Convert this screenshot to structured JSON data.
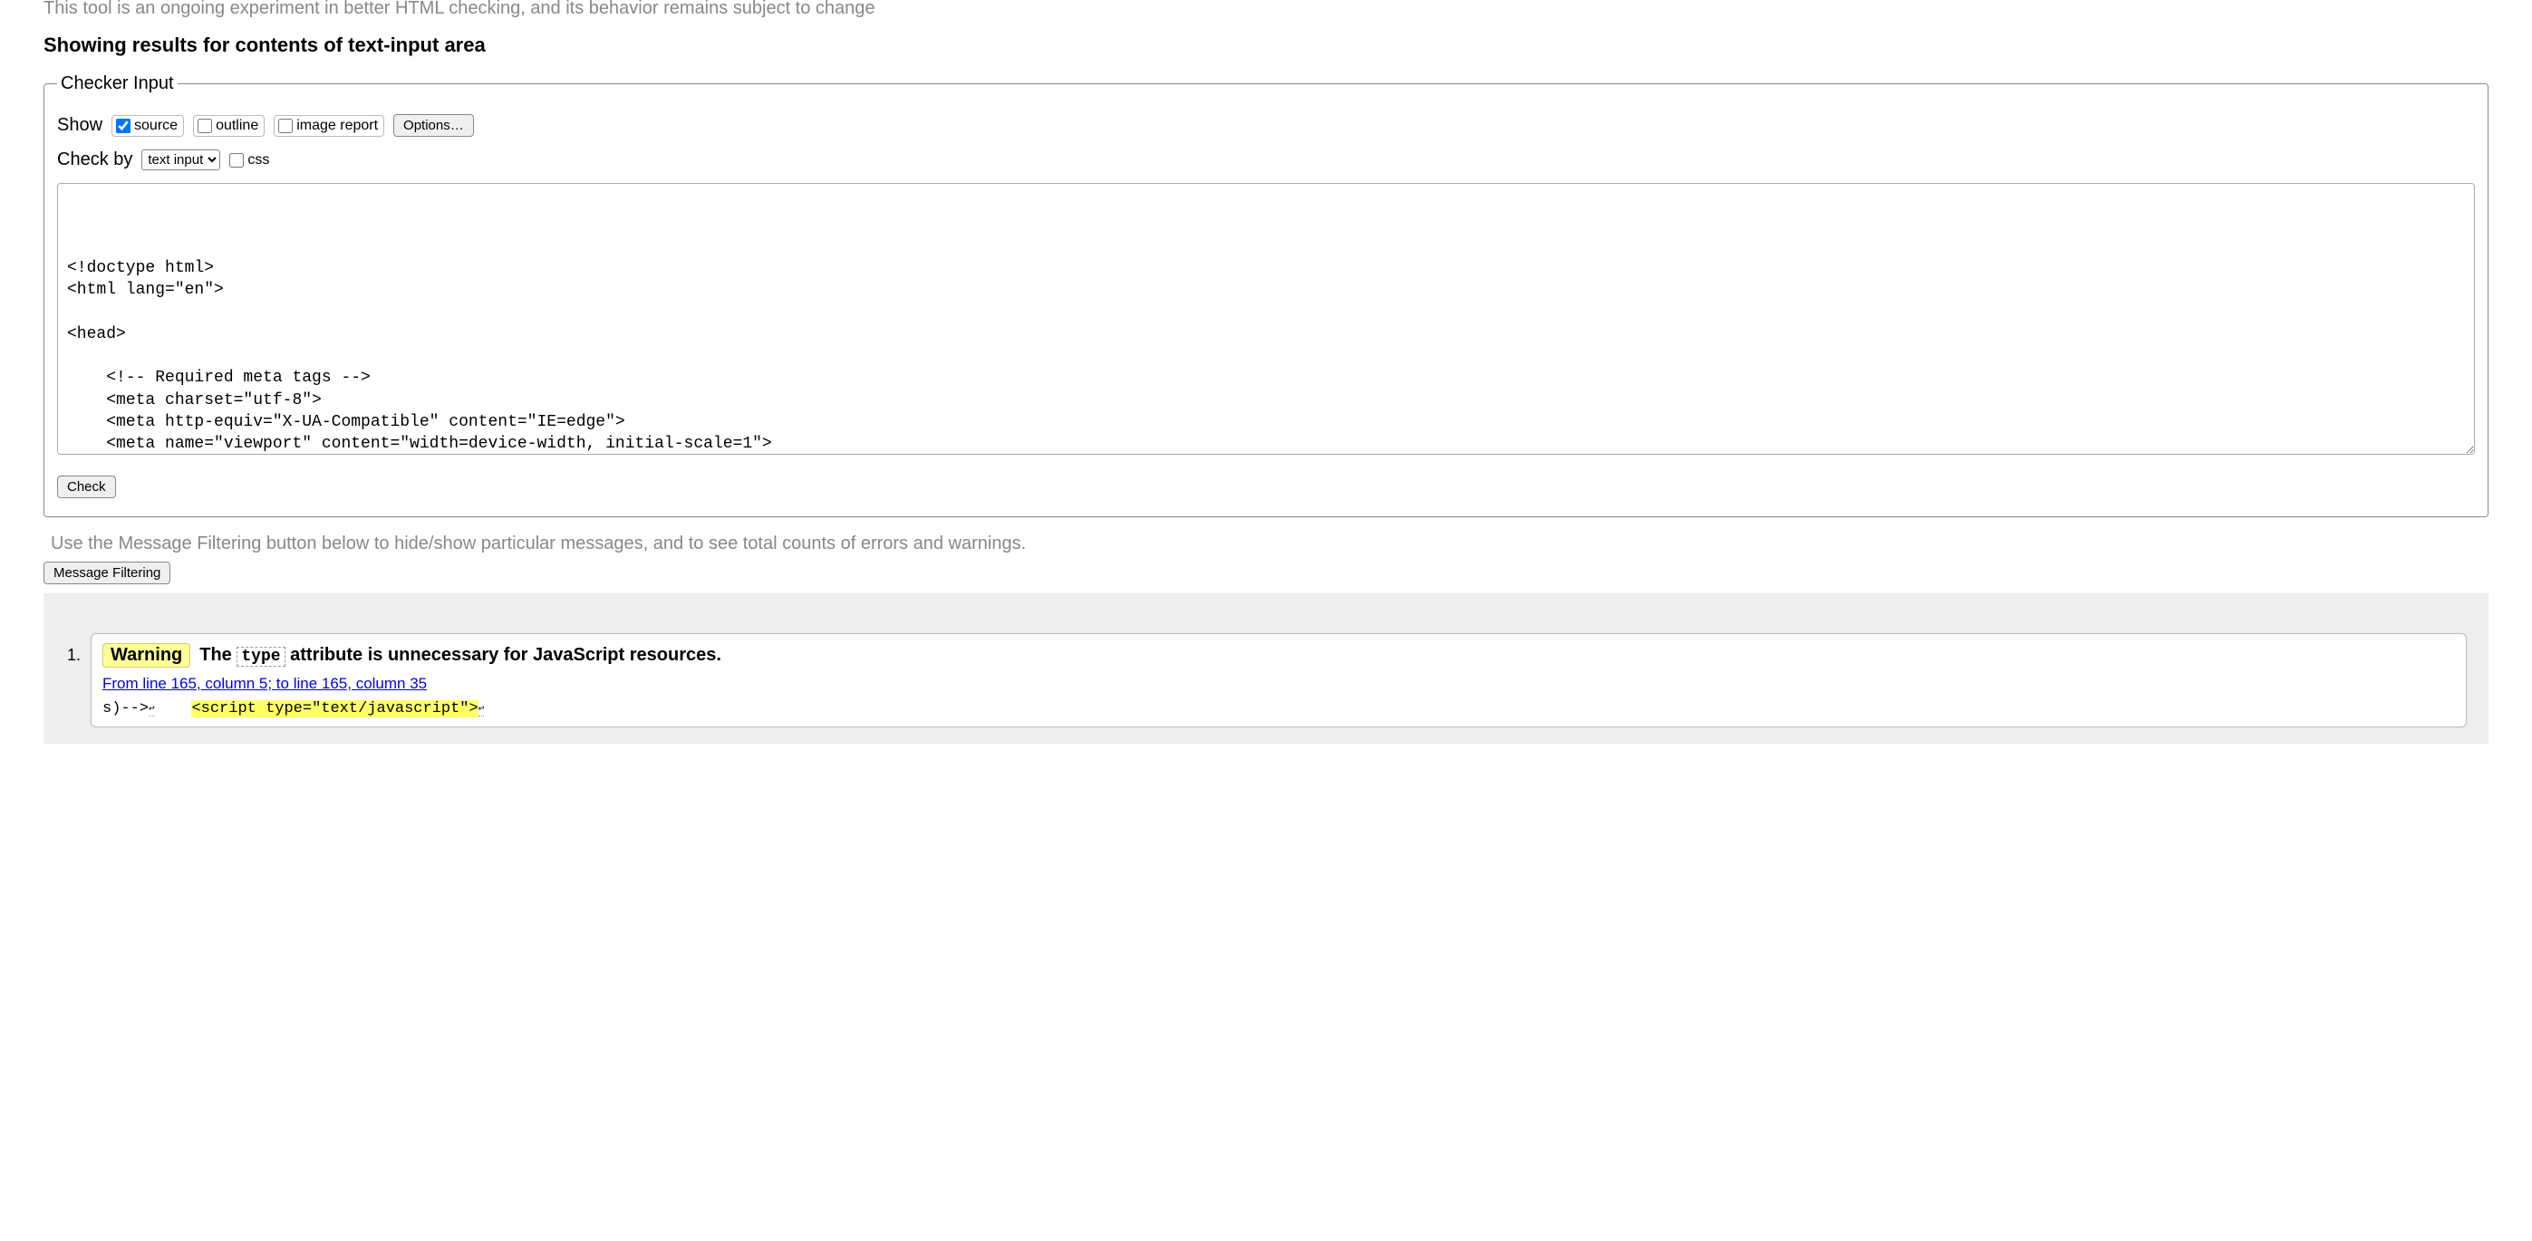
{
  "experiment_note": "This tool is an ongoing experiment in better HTML checking, and its behavior remains subject to change",
  "results_heading": "Showing results for contents of text-input area",
  "checker": {
    "legend": "Checker Input",
    "show_label": "Show",
    "source_label": "source",
    "outline_label": "outline",
    "image_report_label": "image report",
    "options_label": "Options…",
    "check_by_label": "Check by",
    "check_by_value": "text input",
    "css_label": "css",
    "textarea_value": "\n\n\n<!doctype html>\n<html lang=\"en\">\n\n<head>\n\n    <!-- Required meta tags -->\n    <meta charset=\"utf-8\">\n    <meta http-equiv=\"X-UA-Compatible\" content=\"IE=edge\">\n    <meta name=\"viewport\" content=\"width=device-width, initial-scale=1\">\n    <meta name=\"description\" content=\"A Motor Racing Circuit for Trackdays and other Motorsports\">\n    <meta name=\"keywords\" content=\"trackdays, motorsport, motorcircuit, trackday, racing, racetrack\">",
    "check_button": "Check"
  },
  "filter_note": "Use the Message Filtering button below to hide/show particular messages, and to see total counts of errors and warnings.",
  "message_filtering_label": "Message Filtering",
  "results": [
    {
      "badge": "Warning",
      "msg_pre": "The ",
      "msg_code": "type",
      "msg_post": " attribute is unnecessary for JavaScript resources.",
      "location": "From line 165, column 5; to line 165, column 35",
      "extract_pre": "s)-->",
      "extract_gap": "    ",
      "extract_hl": "<script type=\"text/javascript\">"
    }
  ]
}
